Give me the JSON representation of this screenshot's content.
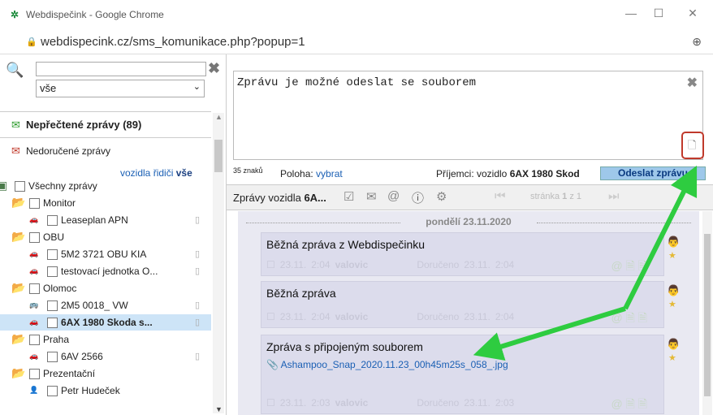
{
  "window": {
    "title": "Webdispečink - Google Chrome",
    "url": "webdispecink.cz/sms_komunikace.php?popup=1"
  },
  "left": {
    "search_value": "",
    "filter_value": "vše",
    "unread_label": "Nepřečtené zprávy (89)",
    "undelivered_label": "Nedoručené zprávy",
    "filter_links": {
      "vehicles": "vozidla",
      "drivers": "řidiči",
      "all": "vše"
    },
    "tree": [
      {
        "label": "Všechny zprávy",
        "kind": "root"
      },
      {
        "label": "Monitor",
        "kind": "folder"
      },
      {
        "label": "Leaseplan APN",
        "kind": "car"
      },
      {
        "label": "OBU",
        "kind": "folder"
      },
      {
        "label": "5M2 3721 OBU KIA",
        "kind": "car"
      },
      {
        "label": "testovací jednotka O...",
        "kind": "car"
      },
      {
        "label": "Olomoc",
        "kind": "folder"
      },
      {
        "label": "2M5 0018_ VW",
        "kind": "bus"
      },
      {
        "label": "6AX 1980 Skoda s...",
        "kind": "car",
        "selected": true
      },
      {
        "label": "Praha",
        "kind": "folder"
      },
      {
        "label": "6AV 2566",
        "kind": "car"
      },
      {
        "label": "Prezentační",
        "kind": "folder"
      },
      {
        "label": "Petr Hudeček",
        "kind": "person"
      }
    ]
  },
  "compose": {
    "text": "Zprávu je možné odeslat se souborem",
    "char_count": "35 znaků",
    "position_label": "Poloha:",
    "position_link": "vybrat",
    "recipients_label": "Příjemci: vozidlo",
    "recipient": "6AX 1980 Skod",
    "send_label": "Odeslat zprávu"
  },
  "toolbar": {
    "title": "Zprávy vozidla",
    "title_bold": "6A...",
    "page_label": "stránka",
    "page": "1",
    "of_label": "z",
    "total": "1"
  },
  "messages": {
    "date": "pondělí 23.11.2020",
    "items": [
      {
        "text": "Běžná zpráva z Webdispečinku",
        "date": "23.11.",
        "time": "2:04",
        "user": "valovic",
        "delivered_label": "Doručeno",
        "delivered_date": "23.11.",
        "delivered_time": "2:04"
      },
      {
        "text": "Běžná zpráva",
        "date": "23.11.",
        "time": "2:04",
        "user": "valovic",
        "delivered_label": "Doručeno",
        "delivered_date": "23.11.",
        "delivered_time": "2:04"
      },
      {
        "text": "Zpráva s připojeným souborem",
        "file": "Ashampoo_Snap_2020.11.23_00h45m25s_058_.jpg",
        "date": "23.11.",
        "time": "2:03",
        "user": "valovic",
        "delivered_label": "Doručeno",
        "delivered_date": "23.11.",
        "delivered_time": "2:03"
      }
    ]
  }
}
